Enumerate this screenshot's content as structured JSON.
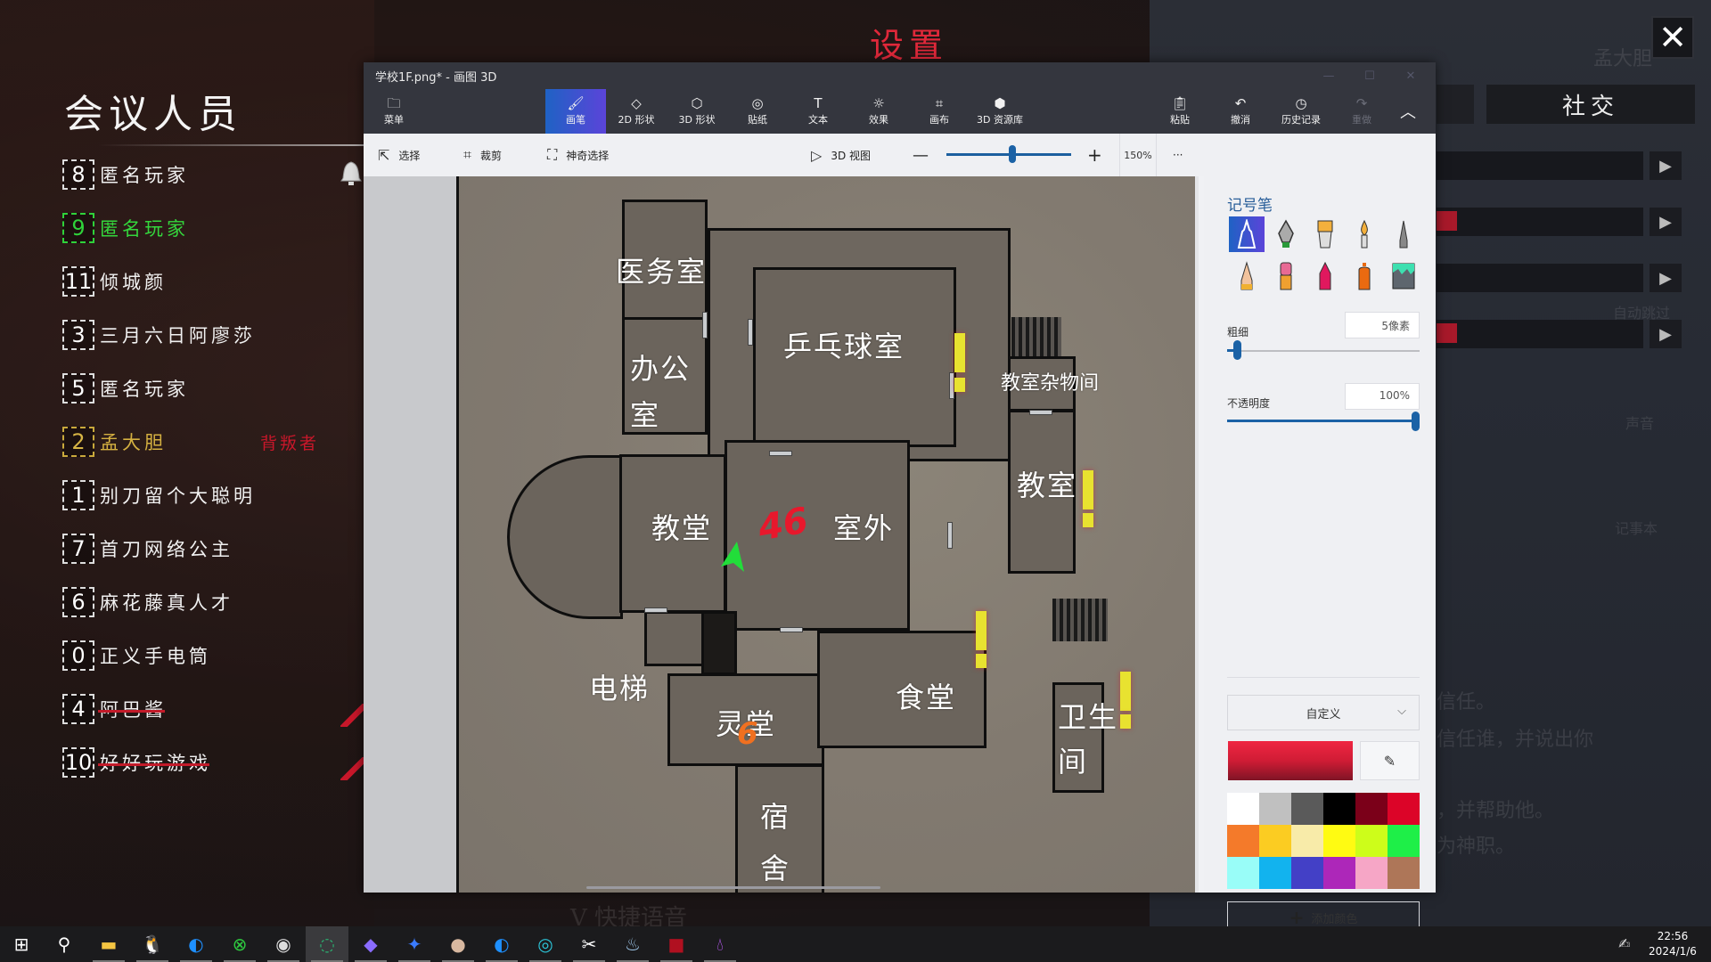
{
  "game": {
    "title": "设置",
    "close_icon": "close-icon",
    "social_tab": "社交",
    "members_title": "会议人员",
    "members": [
      {
        "seat": "8",
        "name": "匿名玩家",
        "state": "normal",
        "tag": ""
      },
      {
        "seat": "9",
        "name": "匿名玩家",
        "state": "green",
        "tag": ""
      },
      {
        "seat": "11",
        "name": "倾城颜",
        "state": "normal",
        "tag": ""
      },
      {
        "seat": "3",
        "name": "三月六日阿廖莎",
        "state": "normal",
        "tag": ""
      },
      {
        "seat": "5",
        "name": "匿名玩家",
        "state": "normal",
        "tag": ""
      },
      {
        "seat": "2",
        "name": "孟大胆",
        "state": "gold",
        "tag": "背叛者"
      },
      {
        "seat": "1",
        "name": "别刀留个大聪明",
        "state": "normal",
        "tag": ""
      },
      {
        "seat": "7",
        "name": "首刀网络公主",
        "state": "normal",
        "tag": ""
      },
      {
        "seat": "6",
        "name": "麻花藤真人才",
        "state": "normal",
        "tag": ""
      },
      {
        "seat": "0",
        "name": "正义手电筒",
        "state": "normal",
        "tag": ""
      },
      {
        "seat": "4",
        "name": "阿巴酱",
        "state": "dead",
        "tag": ""
      },
      {
        "seat": "10",
        "name": "好好玩游戏",
        "state": "dead",
        "tag": ""
      }
    ],
    "settings_rows": [
      {
        "fill_percent": 0
      },
      {
        "fill_percent": 10
      },
      {
        "fill_percent": 0
      },
      {
        "fill_percent": 10
      }
    ],
    "faint_texts": [
      "孟大胆",
      "自动跳过",
      "声音",
      "记事本",
      "信任。",
      "信任谁，并说出你",
      "，并帮助他。",
      "为神职。",
      "V 快捷语音"
    ]
  },
  "paint3d": {
    "window_title": "学校1F.png* - 画图 3D",
    "ribbon": {
      "menu": "菜单",
      "tools": [
        {
          "label": "画笔",
          "icon": "brush-icon",
          "active": true
        },
        {
          "label": "2D 形状",
          "icon": "2d-shapes-icon",
          "active": false
        },
        {
          "label": "3D 形状",
          "icon": "3d-shapes-icon",
          "active": false
        },
        {
          "label": "贴纸",
          "icon": "sticker-icon",
          "active": false
        },
        {
          "label": "文本",
          "icon": "text-icon",
          "active": false
        },
        {
          "label": "效果",
          "icon": "effects-icon",
          "active": false
        },
        {
          "label": "画布",
          "icon": "canvas-icon",
          "active": false
        },
        {
          "label": "3D 资源库",
          "icon": "3d-library-icon",
          "active": false
        }
      ],
      "paste": "粘贴",
      "undo": "撤消",
      "history": "历史记录",
      "redo": "重做"
    },
    "toolbar": {
      "select": "选择",
      "crop": "裁剪",
      "magic_select": "神奇选择",
      "view_3d": "3D 视图",
      "zoom_percent": "150%",
      "zoom_value": 150,
      "more": "···"
    },
    "canvas": {
      "rooms": [
        "医务室",
        "办公室",
        "乒乓球室",
        "教室杂物间",
        "教室",
        "教堂",
        "室外",
        "电梯",
        "灵堂",
        "食堂",
        "卫生间",
        "宿舍"
      ],
      "annotations": [
        {
          "text": "46",
          "color": "#e8182c"
        },
        {
          "text": "6",
          "color": "#f07020"
        }
      ]
    },
    "side_panel": {
      "title": "记号笔",
      "brushes": [
        "marker",
        "calligraphy-pen",
        "oil-brush",
        "watercolor",
        "pixel-pen",
        "pencil",
        "eraser",
        "crayon",
        "spray-can",
        "fill-bucket"
      ],
      "active_brush": "marker",
      "thickness_label": "粗细",
      "thickness_value": "5像素",
      "thickness_fraction": 0.05,
      "opacity_label": "不透明度",
      "opacity_value": "100%",
      "opacity_fraction": 1.0,
      "color_mode": "自定义",
      "current_color": "#e8203a",
      "palette": [
        "#ffffff",
        "#c0c0c0",
        "#5a5a5a",
        "#000000",
        "#7b0019",
        "#dc0428",
        "#f47a2a",
        "#fbcc22",
        "#f8eba9",
        "#fffb12",
        "#cdfd1a",
        "#1eef48",
        "#99fdf8",
        "#12b3ee",
        "#4340c6",
        "#ad27b9",
        "#f6a6c6",
        "#ae7658"
      ],
      "add_color": "添加颜色"
    }
  },
  "taskbar": {
    "apps": [
      "start",
      "search",
      "file-explorer",
      "qq",
      "browser-a",
      "xbox",
      "obs",
      "edge",
      "copilot",
      "feishu",
      "avatar-app",
      "browser-b",
      "game-ring",
      "capcut",
      "steam",
      "game-b",
      "paint3d"
    ],
    "active_app": "edge",
    "time": "22:56",
    "date": "2024/1/6"
  }
}
